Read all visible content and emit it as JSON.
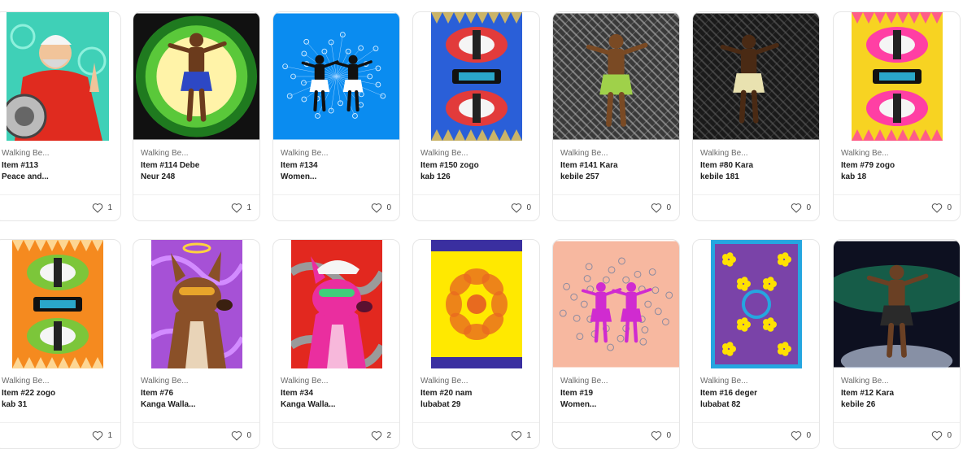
{
  "cards": [
    {
      "collection": "Walking Be...",
      "title_line1": "Item #113",
      "title_line2": "Peace and...",
      "likes": "1",
      "art": "illustrated-man-red-shirt"
    },
    {
      "collection": "Walking Be...",
      "title_line1": "Item #114 Debe",
      "title_line2": "Neur 248",
      "likes": "1",
      "art": "dancer-green-circle"
    },
    {
      "collection": "Walking Be...",
      "title_line1": "Item #134",
      "title_line2": "Women...",
      "likes": "0",
      "art": "dancers-blue-network"
    },
    {
      "collection": "Walking Be...",
      "title_line1": "Item #150 zogo",
      "title_line2": "kab 126",
      "likes": "0",
      "art": "headdress-blue-pattern"
    },
    {
      "collection": "Walking Be...",
      "title_line1": "Item #141 Kara",
      "title_line2": "kebile 257",
      "likes": "0",
      "art": "dancer-grey-pattern"
    },
    {
      "collection": "Walking Be...",
      "title_line1": "Item #80 Kara",
      "title_line2": "kebile 181",
      "likes": "0",
      "art": "dancer-dark-pattern"
    },
    {
      "collection": "Walking Be...",
      "title_line1": "Item #79 zogo",
      "title_line2": "kab 18",
      "likes": "0",
      "art": "headdress-pink-yellow"
    },
    {
      "collection": "Walking Be...",
      "title_line1": "Item #22 zogo",
      "title_line2": "kab 31",
      "likes": "1",
      "art": "headdress-orange-green"
    },
    {
      "collection": "Walking Be...",
      "title_line1": "Item #76",
      "title_line2": "Kanga Walla...",
      "likes": "0",
      "art": "wallaby-brown-purple"
    },
    {
      "collection": "Walking Be...",
      "title_line1": "Item #34",
      "title_line2": "Kanga Walla...",
      "likes": "2",
      "art": "wallaby-pink-red"
    },
    {
      "collection": "Walking Be...",
      "title_line1": "Item #20 nam",
      "title_line2": "lubabat 29",
      "likes": "1",
      "art": "yellow-turtle-pattern"
    },
    {
      "collection": "Walking Be...",
      "title_line1": "Item #19",
      "title_line2": "Women...",
      "likes": "0",
      "art": "dancers-peach"
    },
    {
      "collection": "Walking Be...",
      "title_line1": "Item #16 deger",
      "title_line2": "lubabat 82",
      "likes": "0",
      "art": "purple-flowers-pattern"
    },
    {
      "collection": "Walking Be...",
      "title_line1": "Item #12 Kara",
      "title_line2": "kebile 26",
      "likes": "0",
      "art": "dancer-aurora"
    }
  ]
}
